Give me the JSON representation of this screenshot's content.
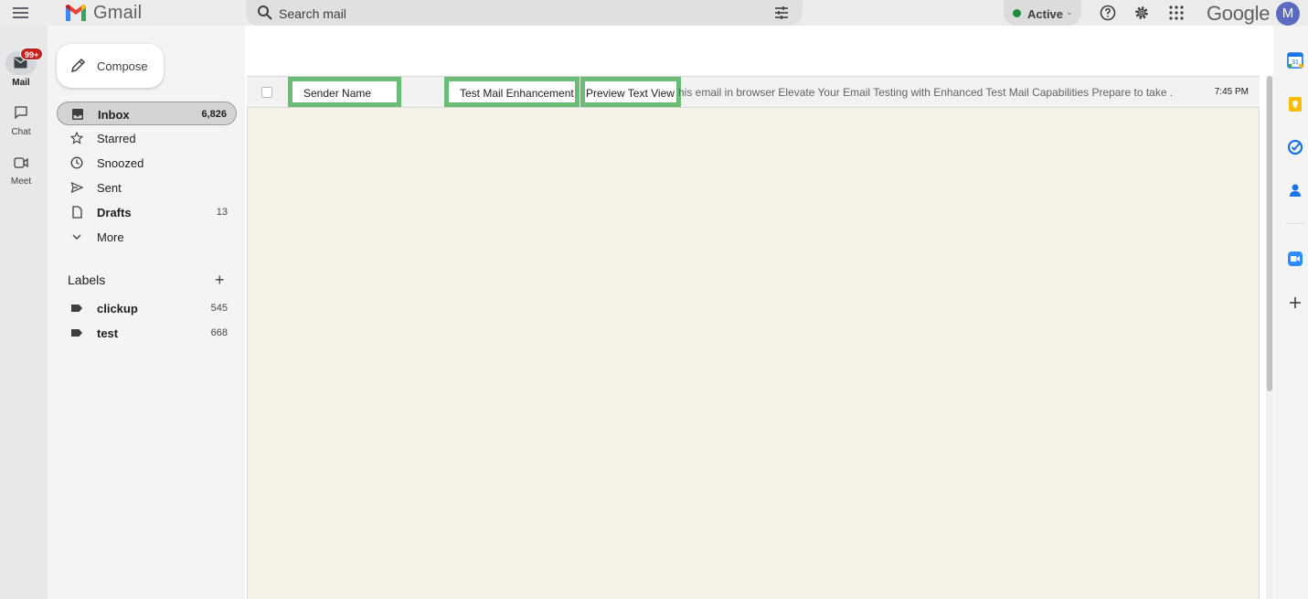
{
  "app": {
    "name": "Gmail",
    "brand_word": "Google",
    "avatar_initial": "M"
  },
  "search": {
    "placeholder": "Search mail"
  },
  "status": {
    "label": "Active",
    "color": "#1e8e3e"
  },
  "rail": {
    "mail_badge": "99+",
    "items": [
      {
        "label": "Mail",
        "icon": "mail-icon"
      },
      {
        "label": "Chat",
        "icon": "chat-icon"
      },
      {
        "label": "Meet",
        "icon": "video-icon"
      }
    ]
  },
  "compose": {
    "label": "Compose"
  },
  "nav": [
    {
      "label": "Inbox",
      "count": "6,826",
      "icon": "inbox-icon"
    },
    {
      "label": "Starred",
      "count": "",
      "icon": "star-icon"
    },
    {
      "label": "Snoozed",
      "count": "",
      "icon": "clock-icon"
    },
    {
      "label": "Sent",
      "count": "",
      "icon": "send-icon"
    },
    {
      "label": "Drafts",
      "count": "13",
      "icon": "draft-icon"
    },
    {
      "label": "More",
      "count": "",
      "icon": "chevron-down-icon"
    }
  ],
  "labels": {
    "heading": "Labels",
    "items": [
      {
        "label": "clickup",
        "count": "545"
      },
      {
        "label": "test",
        "count": "668"
      }
    ]
  },
  "email": {
    "sender": "Sender Name",
    "subject": "Test Mail Enhancement",
    "preview": "Preview Text View",
    "snippet": "his email in browser Elevate Your Email Testing with Enhanced Test Mail Capabilities Prepare to take ...",
    "time": "7:45 PM"
  },
  "colors": {
    "highlight": "#6abd74",
    "body_bg": "#f6f2e7",
    "badge": "#c5221f"
  }
}
